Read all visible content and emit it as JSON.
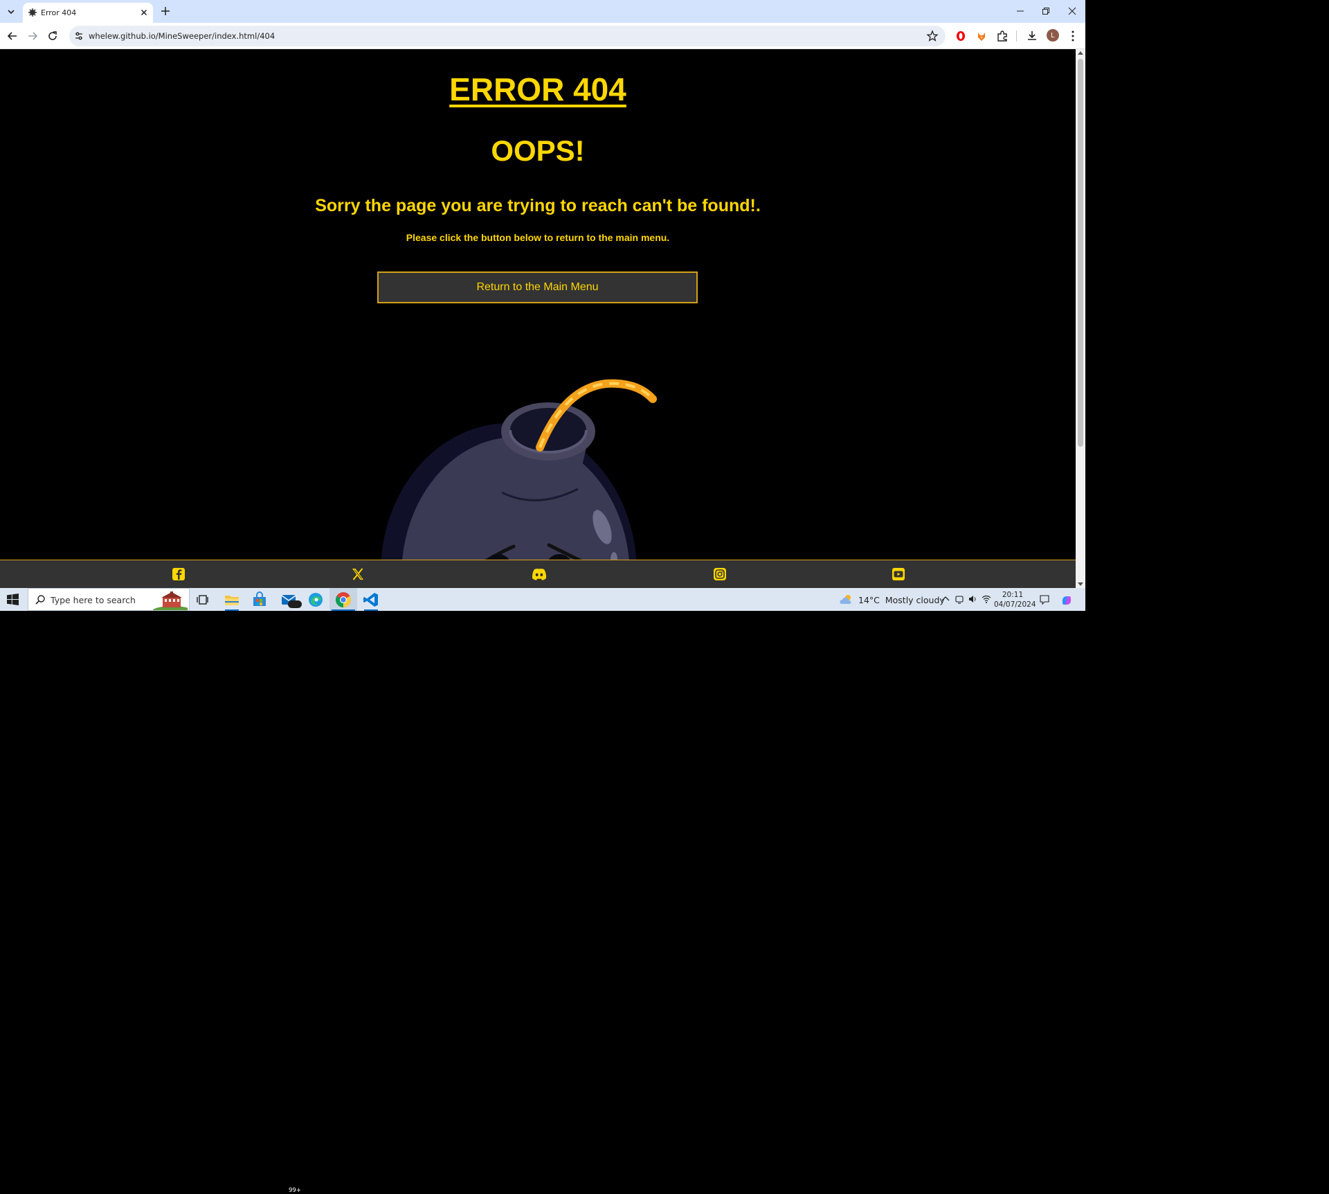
{
  "browser": {
    "tab_title": "Error 404",
    "url": "whelew.github.io/MineSweeper/index.html/404",
    "profile_initial": "L"
  },
  "page": {
    "heading": "ERROR 404",
    "oops": "OOPS!",
    "sorry": "Sorry the page you are trying to reach can't be found!.",
    "instruction": "Please click the button below to return to the main menu.",
    "button_label": "Return to the Main Menu",
    "accent_color": "#ffd700",
    "footer_icons": [
      "facebook-icon",
      "x-twitter-icon",
      "discord-icon",
      "instagram-icon",
      "youtube-icon"
    ]
  },
  "taskbar": {
    "search_placeholder": "Type here to search",
    "mail_badge": "99+",
    "weather_temp": "14°C",
    "weather_desc": "Mostly cloudy",
    "time": "20:11",
    "date": "04/07/2024"
  }
}
